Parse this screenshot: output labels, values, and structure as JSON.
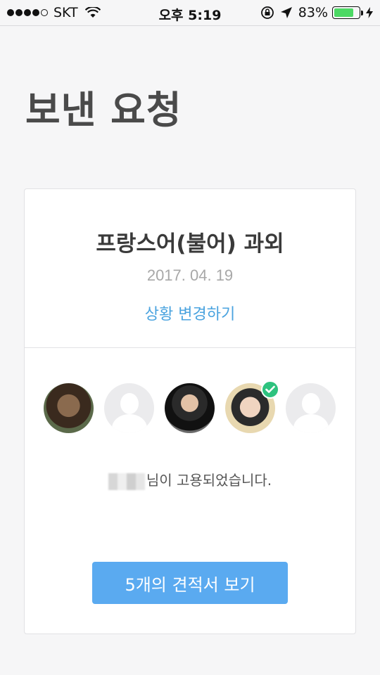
{
  "status_bar": {
    "carrier": "SKT",
    "time": "오후 5:19",
    "battery_percent_label": "83%",
    "battery_level": 0.83,
    "battery_color": "#4cd964"
  },
  "page": {
    "title": "보낸 요청"
  },
  "request": {
    "title": "프랑스어(불어) 과외",
    "date": "2017. 04. 19",
    "change_status_label": "상황 변경하기",
    "hired_message_suffix": "님이 고용되었습니다.",
    "view_quotes_label": "5개의 견적서 보기"
  },
  "avatars": [
    {
      "icon": "avatar-photo",
      "hired": false
    },
    {
      "icon": "avatar-placeholder-icon",
      "hired": false
    },
    {
      "icon": "avatar-photo",
      "hired": false
    },
    {
      "icon": "avatar-photo",
      "hired": true
    },
    {
      "icon": "avatar-placeholder-icon",
      "hired": false
    }
  ],
  "colors": {
    "accent": "#5aaaf0",
    "link": "#4aa3df",
    "hired_badge": "#2ec27e"
  }
}
